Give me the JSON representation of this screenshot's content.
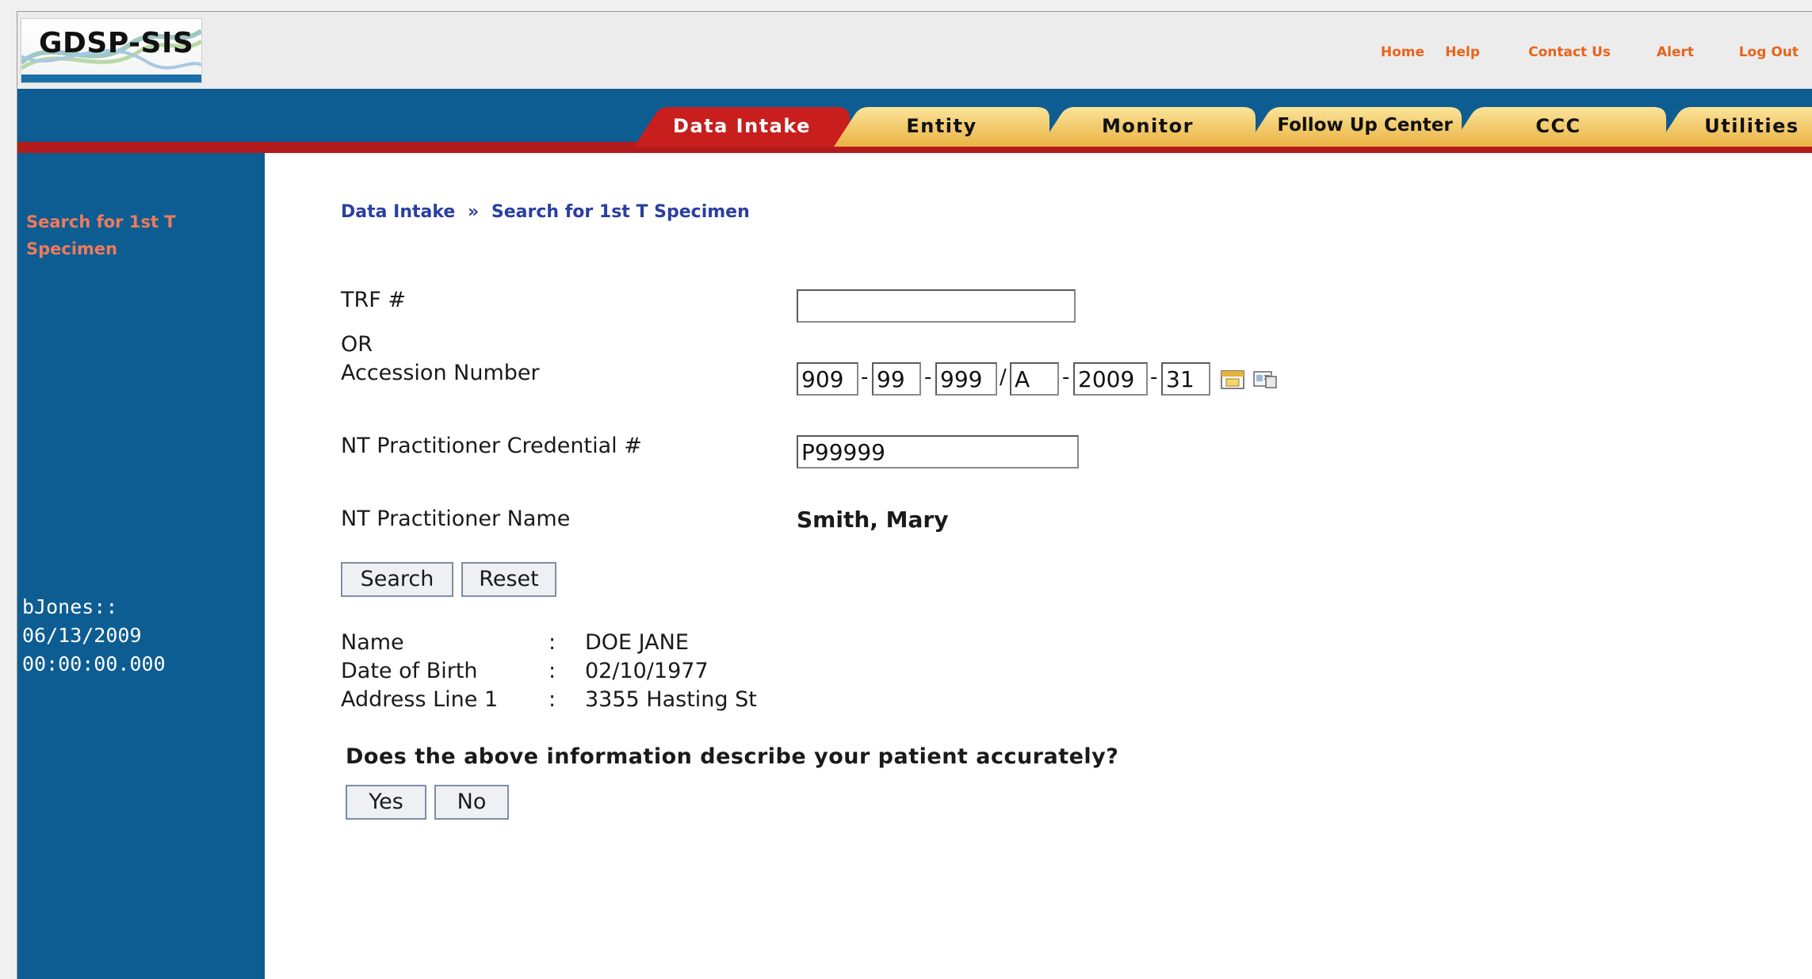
{
  "app": {
    "logo_text": "GDSP-SIS"
  },
  "top_links": [
    "Home",
    "Help",
    "Contact Us",
    "Alert",
    "Log Out"
  ],
  "tabs": [
    {
      "label": "Data Intake",
      "active": true
    },
    {
      "label": "Entity"
    },
    {
      "label": "Monitor"
    },
    {
      "label": "Follow Up Center"
    },
    {
      "label": "CCC"
    },
    {
      "label": "Utilities"
    }
  ],
  "sidebar": {
    "link": "Search for 1st T Specimen",
    "session": [
      "bJones::",
      "06/13/2009",
      "00:00:00.000"
    ]
  },
  "breadcrumb": {
    "root": "Data Intake",
    "separator": "»",
    "current": "Search for 1st T Specimen"
  },
  "form": {
    "trf_label": "TRF #",
    "trf_value": "",
    "or_label": "OR",
    "accession_label": "Accession Number",
    "accession": {
      "part1": "909",
      "part2": "99",
      "part3": "999",
      "part4": "A",
      "part5": "2009",
      "part6": "31",
      "sep_dash": "-",
      "sep_slash": "/"
    },
    "credential_label": "NT Practitioner Credential #",
    "credential_value": "P99999",
    "name_label": "NT Practitioner Name",
    "name_value": "Smith, Mary",
    "search_button": "Search",
    "reset_button": "Reset"
  },
  "patient": {
    "colon": ":",
    "fields": [
      {
        "label": "Name",
        "value": "DOE JANE"
      },
      {
        "label": "Date of Birth",
        "value": "02/10/1977"
      },
      {
        "label": "Address Line 1",
        "value": "3355 Hasting St"
      }
    ]
  },
  "confirm": {
    "question": "Does the above information describe your patient accurately?",
    "yes": "Yes",
    "no": "No"
  },
  "colors": {
    "nav_blue": "#0d5d93",
    "red_rule": "#b21b1b",
    "tab_gold": "#f2c24e",
    "tab_active": "#c81e1e",
    "link_orange": "#e8631a",
    "breadcrumb_blue": "#2a3f9f"
  }
}
